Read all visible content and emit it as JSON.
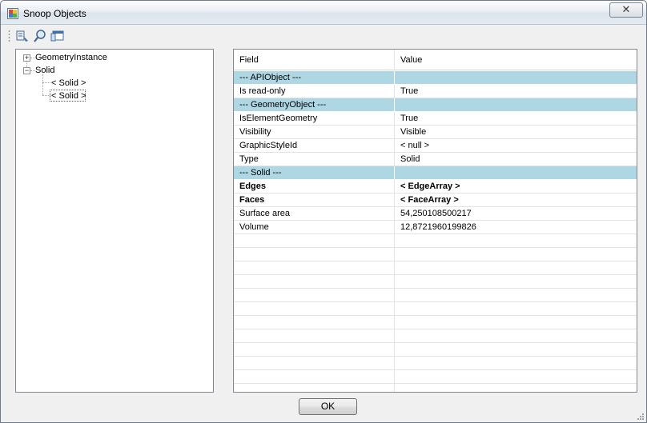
{
  "window": {
    "title": "Snoop Objects",
    "close_label": "✕"
  },
  "toolbar": {
    "buttons": [
      {
        "icon": "snoop-db-icon"
      },
      {
        "icon": "snoop-search-icon"
      },
      {
        "icon": "copy-window-icon"
      }
    ]
  },
  "tree": {
    "nodes": [
      {
        "label": "GeometryInstance",
        "expander": "+"
      },
      {
        "label": "Solid",
        "expander": "−"
      },
      {
        "label": "< Solid >"
      },
      {
        "label": "< Solid >"
      }
    ]
  },
  "grid": {
    "headers": {
      "field": "Field",
      "value": "Value"
    },
    "rows": [
      {
        "field": "--- APIObject ---",
        "value": "",
        "type": "section"
      },
      {
        "field": "Is read-only",
        "value": "True",
        "type": "normal"
      },
      {
        "field": "--- GeometryObject ---",
        "value": "",
        "type": "section"
      },
      {
        "field": "IsElementGeometry",
        "value": "True",
        "type": "normal"
      },
      {
        "field": "Visibility",
        "value": "Visible",
        "type": "normal"
      },
      {
        "field": "GraphicStyleId",
        "value": "< null >",
        "type": "normal"
      },
      {
        "field": "Type",
        "value": "Solid",
        "type": "normal"
      },
      {
        "field": "--- Solid ---",
        "value": "",
        "type": "section"
      },
      {
        "field": "Edges",
        "value": "< EdgeArray >",
        "type": "bold"
      },
      {
        "field": "Faces",
        "value": "< FaceArray >",
        "type": "bold"
      },
      {
        "field": "Surface area",
        "value": "54,250108500217",
        "type": "normal"
      },
      {
        "field": "Volume",
        "value": "12,8721960199826",
        "type": "normal"
      }
    ]
  },
  "footer": {
    "ok_label": "OK"
  },
  "colors": {
    "section_bg": "#aed6e3",
    "grid_line": "#e3e3e3"
  }
}
